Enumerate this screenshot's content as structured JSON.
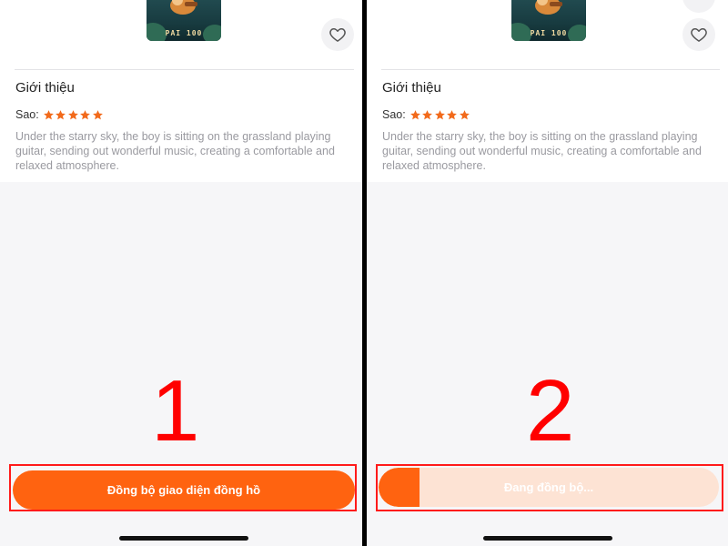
{
  "colors": {
    "accent": "#ff6310",
    "accent_light": "#fde3d4",
    "annotation": "#ff0000",
    "star": "#f26a1b"
  },
  "panels": [
    {
      "thumbnail": {
        "caption": "PAI 100"
      },
      "section_title": "Giới thiệu",
      "rating": {
        "label": "Sao:",
        "stars": 5,
        "max": 5
      },
      "description": "Under the starry sky, the boy is sitting on the grassland playing guitar, sending out wonderful music, creating a comfortable and relaxed atmosphere.",
      "step_number": "1",
      "button": {
        "label": "Đồng bộ giao diện đồng hồ"
      }
    },
    {
      "thumbnail": {
        "caption": "PAI 100"
      },
      "section_title": "Giới thiệu",
      "rating": {
        "label": "Sao:",
        "stars": 5,
        "max": 5
      },
      "description": "Under the starry sky, the boy is sitting on the grassland playing guitar, sending out wonderful music, creating a comfortable and relaxed atmosphere.",
      "step_number": "2",
      "button": {
        "label": "Đang đồng bộ...",
        "progress": 0.12
      }
    }
  ],
  "icons": {
    "favorite": "heart-outline-icon",
    "star": "star-icon"
  }
}
